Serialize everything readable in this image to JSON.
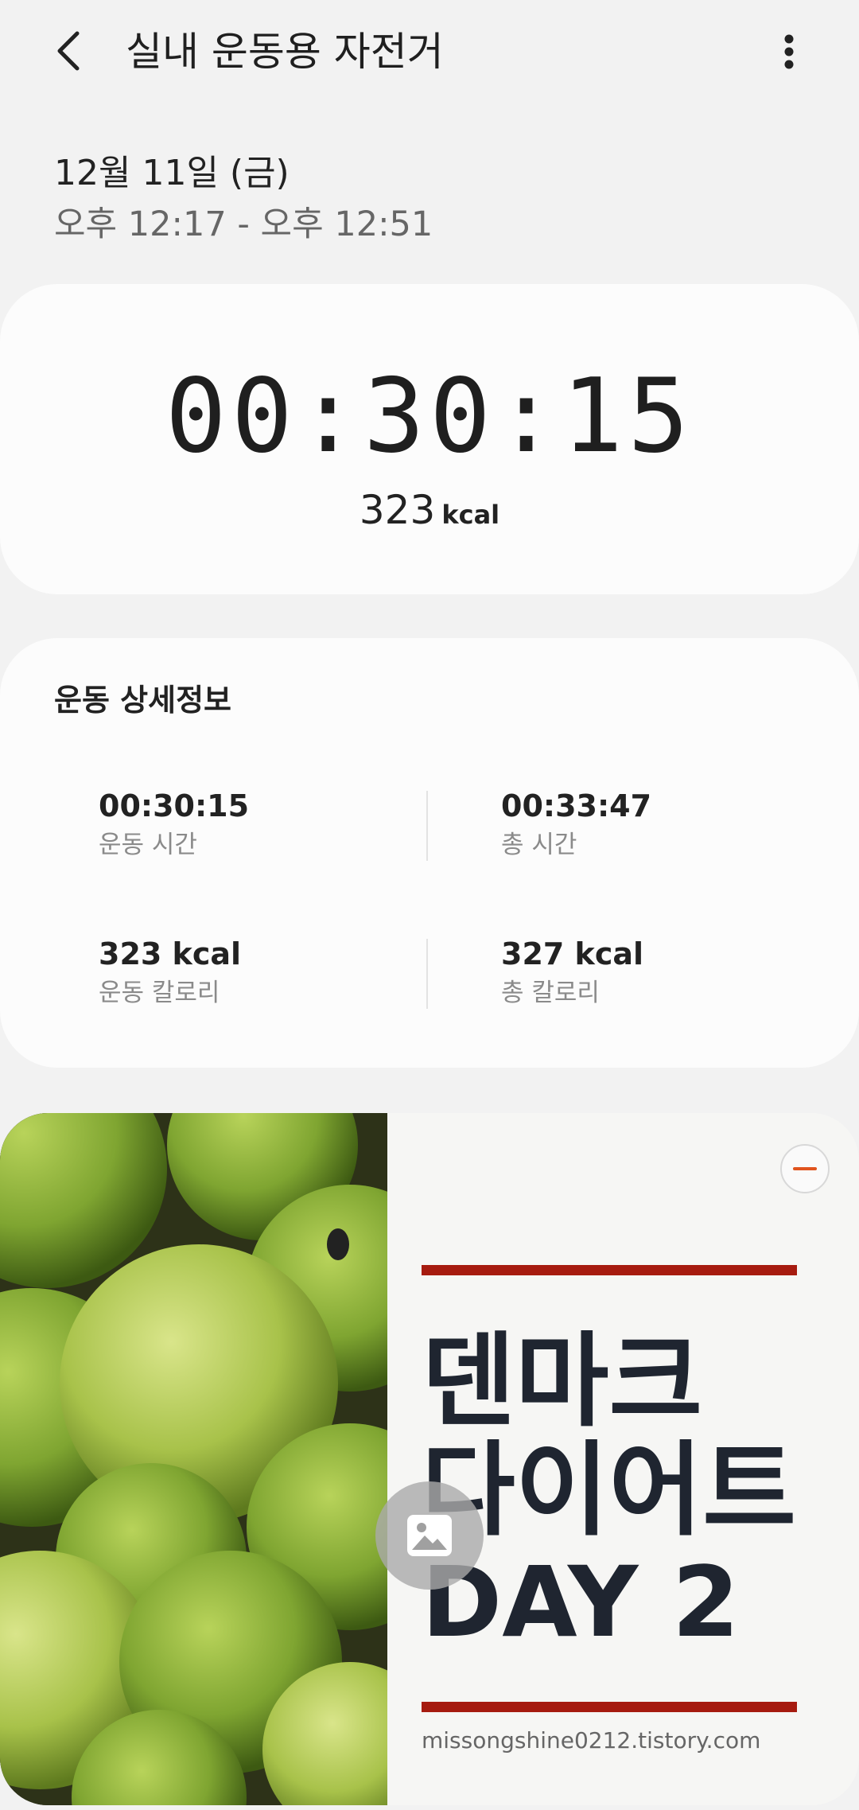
{
  "header": {
    "title": "실내 운동용 자전거",
    "back_icon": "chevron-left-icon",
    "more_icon": "vertical-dots-icon"
  },
  "session": {
    "date": "12월 11일 (금)",
    "time_range": "오후 12:17 - 오후 12:51"
  },
  "summary": {
    "duration": "00:30:15",
    "kcal_value": "323",
    "kcal_unit": "kcal"
  },
  "details": {
    "title": "운동 상세정보",
    "stats": [
      {
        "value": "00:30:15",
        "label": "운동 시간"
      },
      {
        "value": "00:33:47",
        "label": "총 시간"
      },
      {
        "value": "323 kcal",
        "label": "운동 칼로리"
      },
      {
        "value": "327 kcal",
        "label": "총 칼로리"
      }
    ]
  },
  "attachment": {
    "poster_lines": [
      "덴마크",
      "다이어트",
      "DAY 2"
    ],
    "poster_url": "missongshine0212.tistory.com",
    "remove_icon": "minus-circle-icon",
    "gallery_icon": "image-icon",
    "colors": {
      "red_bar": "#a61b0f",
      "poster_text": "#1f2530",
      "remove_accent": "#e0541e"
    }
  }
}
